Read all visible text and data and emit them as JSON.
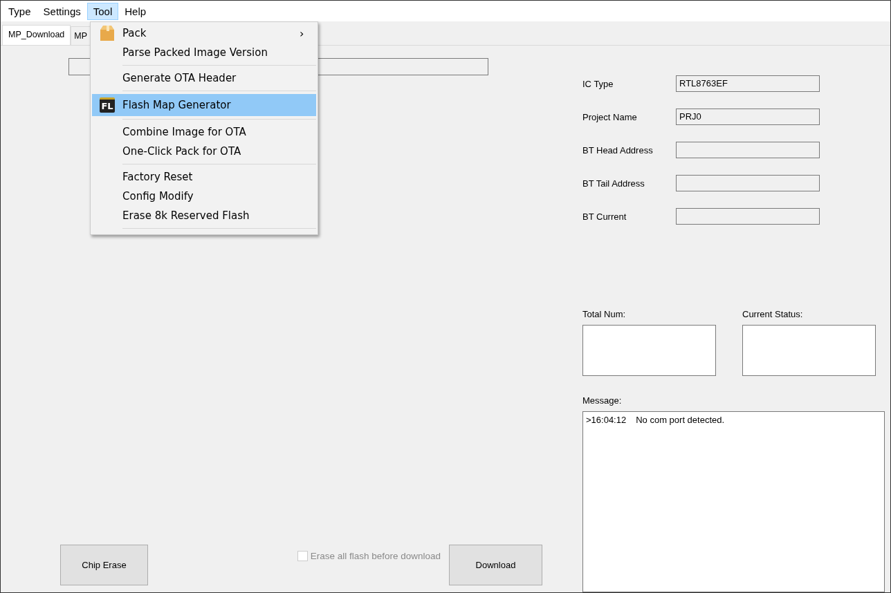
{
  "menu_bar": [
    {
      "label": "Type",
      "active": false
    },
    {
      "label": "Settings",
      "active": false
    },
    {
      "label": "Tool",
      "active": true
    },
    {
      "label": "Help",
      "active": false
    }
  ],
  "tabs": [
    {
      "label": "MP_Download",
      "selected": true
    },
    {
      "label": "MP",
      "selected": false
    }
  ],
  "tool_menu": {
    "groups": [
      [
        {
          "label": "Pack",
          "kind": "package",
          "submenu": true,
          "selected": false
        },
        {
          "label": "Parse Packed Image Version",
          "submenu": false,
          "selected": false
        }
      ],
      [
        {
          "label": "Generate OTA Header",
          "submenu": false,
          "selected": false
        }
      ],
      [
        {
          "label": "Flash Map Generator",
          "kind": "flash",
          "icon_label": "FL",
          "submenu": false,
          "selected": true
        }
      ],
      [
        {
          "label": "Combine Image for OTA",
          "submenu": false,
          "selected": false
        },
        {
          "label": "One-Click Pack for OTA",
          "submenu": false,
          "selected": false
        }
      ],
      [
        {
          "label": "Factory Reset",
          "submenu": false,
          "selected": false
        },
        {
          "label": "Config Modify",
          "submenu": false,
          "selected": false
        },
        {
          "label": "Erase 8k Reserved Flash",
          "submenu": false,
          "selected": false
        }
      ]
    ],
    "submenu_glyph": "›"
  },
  "fields": [
    {
      "label": "IC Type",
      "value": "RTL8763EF"
    },
    {
      "label": "Project Name",
      "value": "PRJ0"
    },
    {
      "label": "BT Head Address"
    },
    {
      "label": "BT Tail Address"
    },
    {
      "label": "BT Current"
    }
  ],
  "total_num": {
    "label": "Total Num:"
  },
  "current_status": {
    "label": "Current Status:"
  },
  "message": {
    "label": "Message:",
    "lines": [
      {
        "time": ">16:04:12",
        "text": "No com port detected."
      }
    ]
  },
  "chip_erase_button": "Chip Erase",
  "erase_checkbox": {
    "label": "Erase all flash before download",
    "checked": false,
    "disabled": true
  },
  "download_button": "Download"
}
